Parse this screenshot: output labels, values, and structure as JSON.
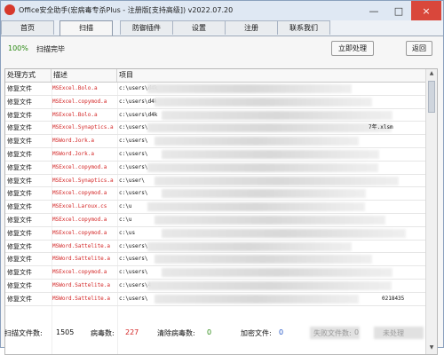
{
  "window": {
    "title": "Office安全助手(宏病毒专杀Plus - 注册版[支持高级]) v2022.07.20",
    "controls": [
      "—",
      "□",
      "×"
    ]
  },
  "tabs": [
    "首页",
    "扫描",
    "防御插件",
    "设置",
    "注册",
    "联系我们"
  ],
  "scan": {
    "progress": "100%",
    "status": "扫描完毕",
    "process_button": "立即处理",
    "back_button": "返回"
  },
  "table": {
    "headers": [
      "处理方式",
      "描述",
      "项目"
    ],
    "rows": [
      {
        "action": "修复文件",
        "desc": "MSExcel.Bolo.a",
        "path": "c:\\users\\d4k"
      },
      {
        "action": "修复文件",
        "desc": "MSExcel.copymod.a",
        "path": "c:\\users\\d4k"
      },
      {
        "action": "修复文件",
        "desc": "MSExcel.Bolo.a",
        "path": "c:\\users\\d4k"
      },
      {
        "action": "修复文件",
        "desc": "MSExcel.Synaptics.a",
        "path": "c:\\users\\",
        "suffix": "7年.xlsm"
      },
      {
        "action": "修复文件",
        "desc": "MSWord.Jork.a",
        "path": "c:\\users\\"
      },
      {
        "action": "修复文件",
        "desc": "MSWord.Jork.a",
        "path": "c:\\users\\"
      },
      {
        "action": "修复文件",
        "desc": "MSExcel.copymod.a",
        "path": "c:\\users\\"
      },
      {
        "action": "修复文件",
        "desc": "MSExcel.Synaptics.a",
        "path": "c:\\user\\"
      },
      {
        "action": "修复文件",
        "desc": "MSExcel.copymod.a",
        "path": "c:\\users\\"
      },
      {
        "action": "修复文件",
        "desc": "MSExcel.Laroux.cs",
        "path": "c:\\u"
      },
      {
        "action": "修复文件",
        "desc": "MSExcel.copymod.a",
        "path": "c:\\u"
      },
      {
        "action": "修复文件",
        "desc": "MSExcel.copymod.a",
        "path": "c:\\us"
      },
      {
        "action": "修复文件",
        "desc": "MSWord.Sattelite.a",
        "path": "c:\\users\\"
      },
      {
        "action": "修复文件",
        "desc": "MSWord.Sattelite.a",
        "path": "c:\\users\\"
      },
      {
        "action": "修复文件",
        "desc": "MSExcel.copymod.a",
        "path": "c:\\users\\"
      },
      {
        "action": "修复文件",
        "desc": "MSWord.Sattelite.a",
        "path": "c:\\users\\4"
      },
      {
        "action": "修复文件",
        "desc": "MSWord.Sattelite.a",
        "path": "c:\\users\\",
        "suffix": "0218435"
      }
    ]
  },
  "footer": {
    "scanned_label": "扫描文件数:",
    "scanned_value": "1505",
    "virus_label": "病毒数:",
    "virus_value": "227",
    "cleared_label": "清除病毒数:",
    "cleared_value": "0",
    "encrypted_label": "加密文件:",
    "encrypted_value": "0",
    "failed_label": "失败文件数:",
    "failed_value": "0",
    "more_label": "未处理"
  },
  "colors": {
    "accent_red": "#d32424",
    "accent_green": "#2b8a13",
    "title_bg": "#dfe8f3"
  }
}
